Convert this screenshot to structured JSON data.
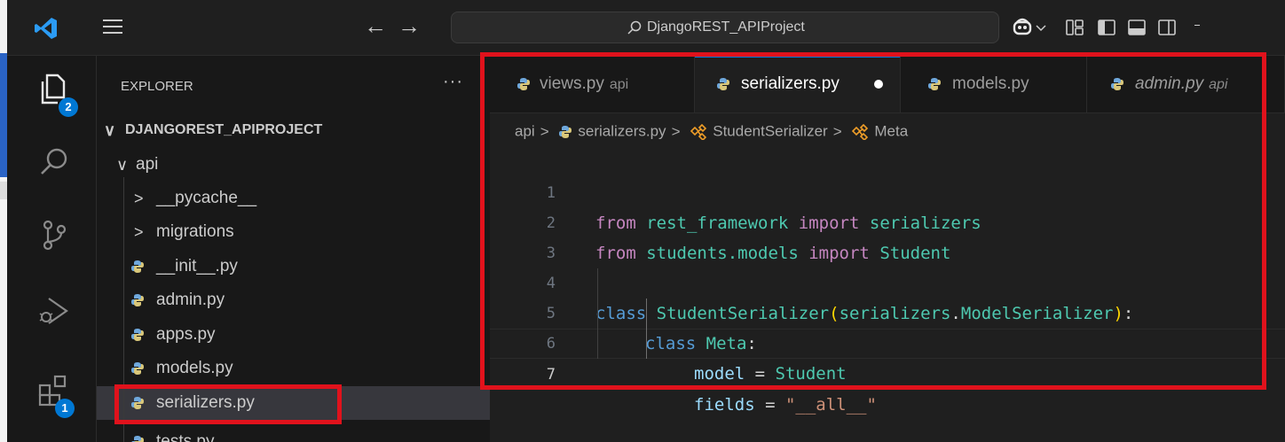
{
  "titlebar": {
    "search_text": "DjangoREST_APIProject",
    "back_icon": "arrow-left-icon",
    "forward_icon": "arrow-right-icon"
  },
  "activity_bar": {
    "explorer_badge": "2",
    "extensions_badge": "1"
  },
  "sidebar": {
    "title": "EXPLORER",
    "more": "···",
    "root": "DJANGOREST_APIPROJECT",
    "items": [
      {
        "label": "api",
        "kind": "folder-open"
      },
      {
        "label": "__pycache__",
        "kind": "folder"
      },
      {
        "label": "migrations",
        "kind": "folder"
      },
      {
        "label": "__init__.py",
        "kind": "file"
      },
      {
        "label": "admin.py",
        "kind": "file"
      },
      {
        "label": "apps.py",
        "kind": "file"
      },
      {
        "label": "models.py",
        "kind": "file"
      },
      {
        "label": "serializers.py",
        "kind": "file",
        "selected": true
      },
      {
        "label": "tests.py",
        "kind": "file"
      }
    ]
  },
  "tabs": [
    {
      "name": "views.py",
      "desc": "api"
    },
    {
      "name": "serializers.py",
      "active": true,
      "modified": true
    },
    {
      "name": "models.py"
    },
    {
      "name": "admin.py",
      "desc": "api",
      "italic": true
    }
  ],
  "breadcrumb": [
    "api",
    "serializers.py",
    "StudentSerializer",
    "Meta"
  ],
  "code": {
    "line_numbers": [
      "1",
      "2",
      "3",
      "4",
      "5",
      "6",
      "7"
    ],
    "l1": [
      "from",
      " rest_framework ",
      "import",
      " serializers"
    ],
    "l2": [
      "from",
      " students.models ",
      "import",
      " Student"
    ],
    "l4": [
      "class",
      " ",
      "StudentSerializer",
      "(",
      "serializers",
      ".",
      "ModelSerializer",
      ")",
      ":"
    ],
    "l5": [
      "class",
      " ",
      "Meta",
      ":"
    ],
    "l6": [
      "model",
      " = ",
      "Student"
    ],
    "l7": [
      "fields",
      " = ",
      "\"__all__\""
    ]
  },
  "colors": {
    "annotation": "#e0121c",
    "accent": "#0078d4",
    "editor_bg": "#1f1f1f"
  }
}
